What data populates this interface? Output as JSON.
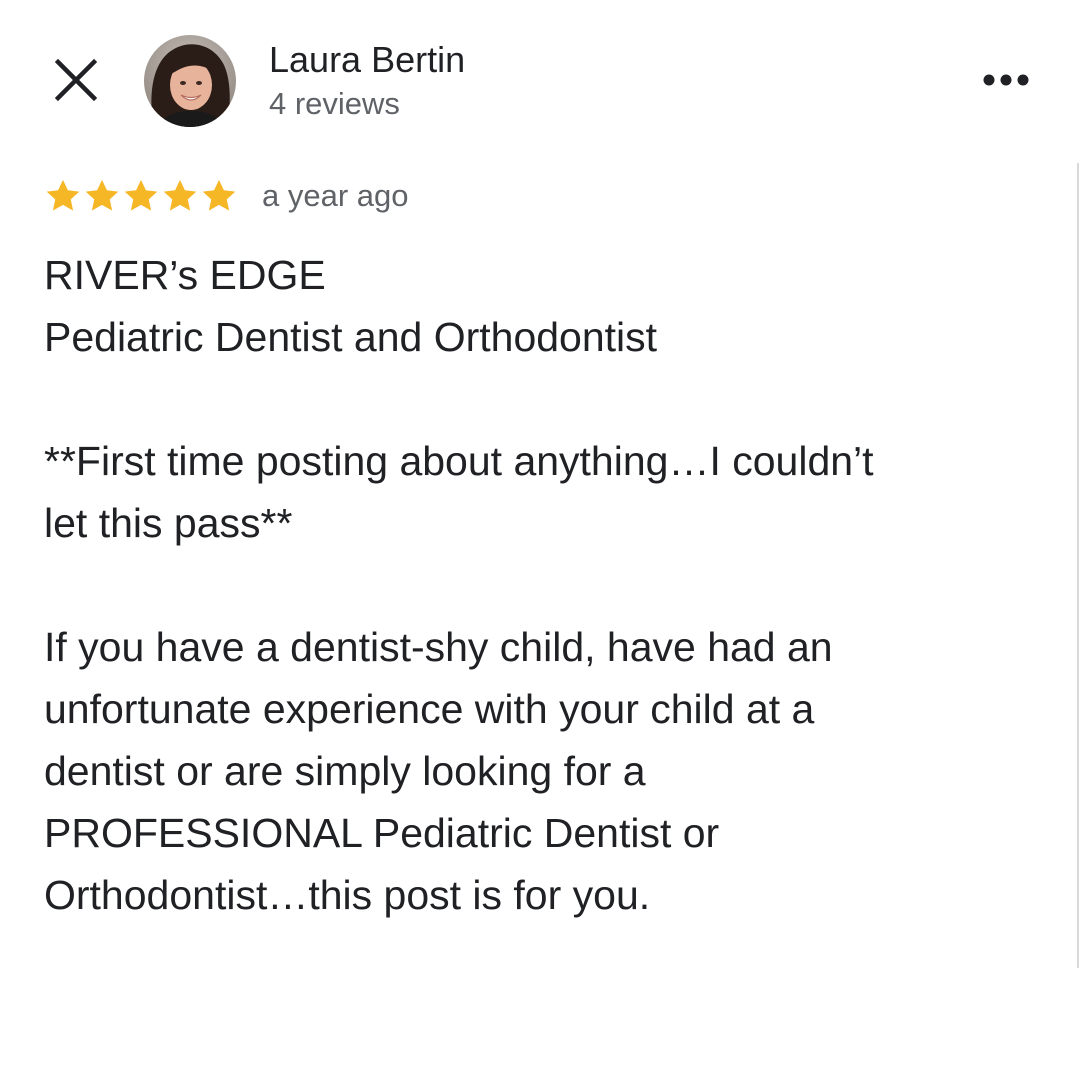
{
  "header": {
    "close_icon": "close-icon",
    "author_name": "Laura Bertin",
    "review_count": "4 reviews",
    "more_icon": "more-options-icon"
  },
  "review": {
    "rating": 5,
    "rating_max": 5,
    "star_color": "#F6B726",
    "timestamp": "a year ago",
    "paragraphs": [
      [
        "RIVER’s EDGE",
        "Pediatric Dentist and Orthodontist"
      ],
      [
        "**First time posting about anything…I couldn’t",
        "let this pass**"
      ],
      [
        "If you have a dentist-shy child, have had an",
        "unfortunate experience with your child at a",
        "dentist or are simply looking for a",
        "PROFESSIONAL Pediatric Dentist or",
        "Orthodontist…this post is for you."
      ]
    ]
  }
}
